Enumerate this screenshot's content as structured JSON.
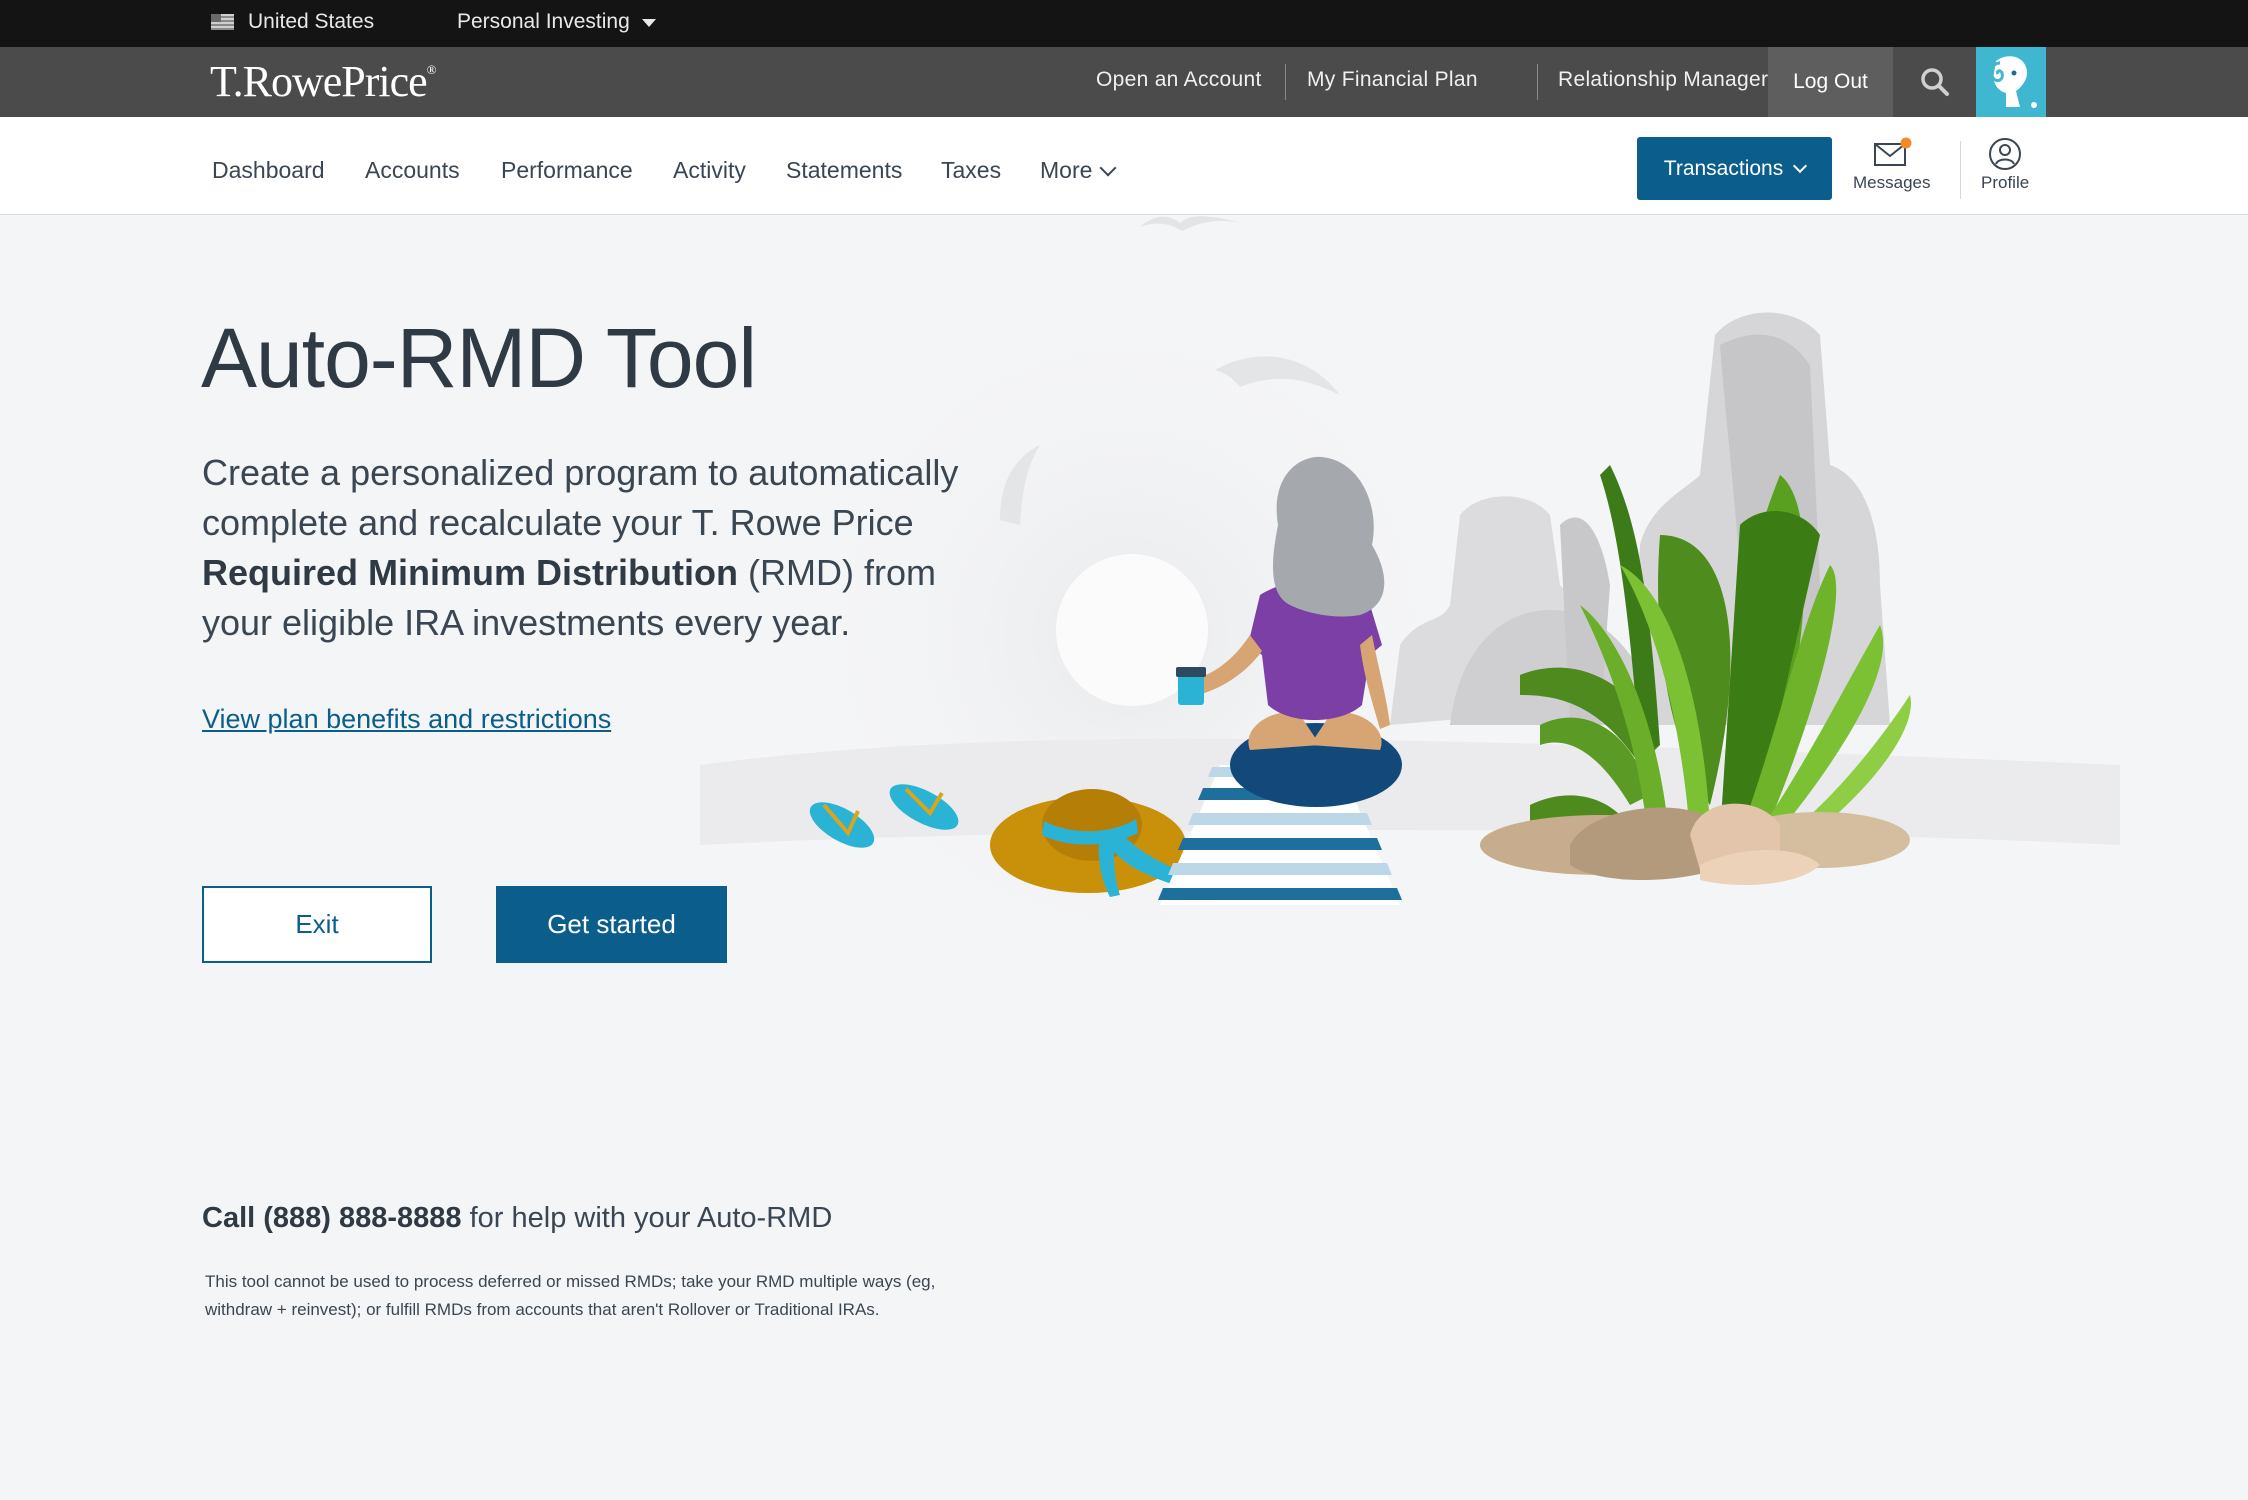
{
  "utility": {
    "region": "United States",
    "segment": "Personal Investing"
  },
  "brand": {
    "logo_text": "T.RowePrice",
    "logo_mark": "®",
    "links": [
      "Open an Account",
      "My Financial Plan",
      "Relationship Manager"
    ],
    "logout_label": "Log Out"
  },
  "nav": {
    "items": [
      "Dashboard",
      "Accounts",
      "Performance",
      "Activity",
      "Statements",
      "Taxes"
    ],
    "more_label": "More",
    "transactions_label": "Transactions",
    "messages_label": "Messages",
    "profile_label": "Profile"
  },
  "hero": {
    "title": "Auto-RMD Tool",
    "intro_part1": "Create a personalized program to automatically complete and recalculate your T. Rowe Price ",
    "intro_bold": "Required Minimum Distribution",
    "intro_part2": " (RMD) from your eligible IRA investments every year.",
    "benefits_link": "View plan benefits and restrictions",
    "exit_label": "Exit",
    "start_label": "Get started"
  },
  "help": {
    "call_bold": "Call (888) 888-8888",
    "call_rest": " for help with your Auto-RMD",
    "disclaimer": "This tool cannot be used to process deferred or missed RMDs; take your RMD multiple ways (eg, withdraw + reinvest); or fulfill RMDs from accounts that aren't Rollover or Traditional IRAs."
  },
  "colors": {
    "primary": "#0b5e8c",
    "brand_bar": "#4b4b4b",
    "utility_bar": "#141414",
    "logo_tile": "#3fb7d1",
    "notification_dot": "#f28a2c"
  },
  "icons": [
    "us-flag-icon",
    "caret-down-icon",
    "search-icon",
    "ram-logo-icon",
    "chevron-down-icon",
    "envelope-icon",
    "user-icon"
  ]
}
